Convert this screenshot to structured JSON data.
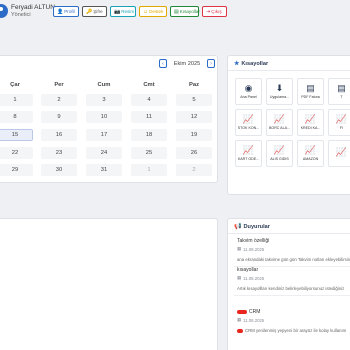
{
  "user": {
    "name": "Feryadi ALTUN",
    "role": "Yönetici"
  },
  "top_buttons": [
    {
      "label": "Profil",
      "icon": "user-icon",
      "glyph": "👤",
      "color": "#2d6cc6"
    },
    {
      "label": "Şifre",
      "icon": "key-icon",
      "glyph": "🔑",
      "color": "#555555"
    },
    {
      "label": "Resim",
      "icon": "camera-icon",
      "glyph": "📷",
      "color": "#17a2b8"
    },
    {
      "label": "Destek",
      "icon": "support-icon",
      "glyph": "☺",
      "color": "#e0a800"
    },
    {
      "label": "Kısayollar",
      "icon": "shortcuts-icon",
      "glyph": "▤",
      "color": "#218838"
    },
    {
      "label": "Çıkış",
      "icon": "logout-icon",
      "glyph": "⇥",
      "color": "#dc3545"
    }
  ],
  "calendar": {
    "month": "Ekim 2025",
    "prev": "‹",
    "next": "›",
    "weekdays": [
      "Çar",
      "Per",
      "Cum",
      "Cmt",
      "Paz"
    ],
    "weeks": [
      [
        "1",
        "2",
        "3",
        "4",
        "5"
      ],
      [
        "8",
        "9",
        "10",
        "11",
        "12"
      ],
      [
        "15",
        "16",
        "17",
        "18",
        "19"
      ],
      [
        "22",
        "23",
        "24",
        "25",
        "26"
      ],
      [
        "29",
        "30",
        "31",
        "1",
        "2"
      ]
    ],
    "today": "15"
  },
  "shortcuts": {
    "title": "Kısayollar",
    "items": [
      {
        "label": "Ana Panel",
        "icon": "dashboard-icon",
        "glyph": "◉"
      },
      {
        "label": "Uygulama...",
        "icon": "download-icon",
        "glyph": "⬇"
      },
      {
        "label": "PDF Fatura",
        "icon": "pdf-icon",
        "glyph": "▤"
      },
      {
        "label": "T",
        "icon": "document-icon",
        "glyph": "▤"
      },
      {
        "label": "STOK KON...",
        "icon": "chart-icon",
        "glyph": "📈"
      },
      {
        "label": "BORC ALA...",
        "icon": "chart-icon",
        "glyph": "📈"
      },
      {
        "label": "KREDI KA...",
        "icon": "chart-icon",
        "glyph": "📈"
      },
      {
        "label": "FI",
        "icon": "chart-icon",
        "glyph": "📈"
      },
      {
        "label": "KART ODE...",
        "icon": "chart-icon",
        "glyph": "📈"
      },
      {
        "label": "ALIS GIDIS",
        "icon": "chart-icon",
        "glyph": "📈"
      },
      {
        "label": "AMAZON",
        "icon": "chart-icon",
        "glyph": "📈"
      },
      {
        "label": "",
        "icon": "chart-icon",
        "glyph": "📈"
      }
    ]
  },
  "announcements": {
    "title": "Duyurular",
    "items": [
      {
        "title": "Takvim özelliği",
        "date": "11.08.2025",
        "text": "ana ekrandaki takvime gün gün Takvim notları ekleyebilirsiniz"
      },
      {
        "title": "kısayollar",
        "date": "11.08.2025",
        "text": "Artık kısayollları kendiniz belirleyebiliyorsunuz istediğiniz"
      },
      {
        "title": "CRM",
        "date": "11.08.2025",
        "text": "CRM yenilenmiş yepyeni bir arayüz ile kolay kullanım"
      }
    ]
  }
}
